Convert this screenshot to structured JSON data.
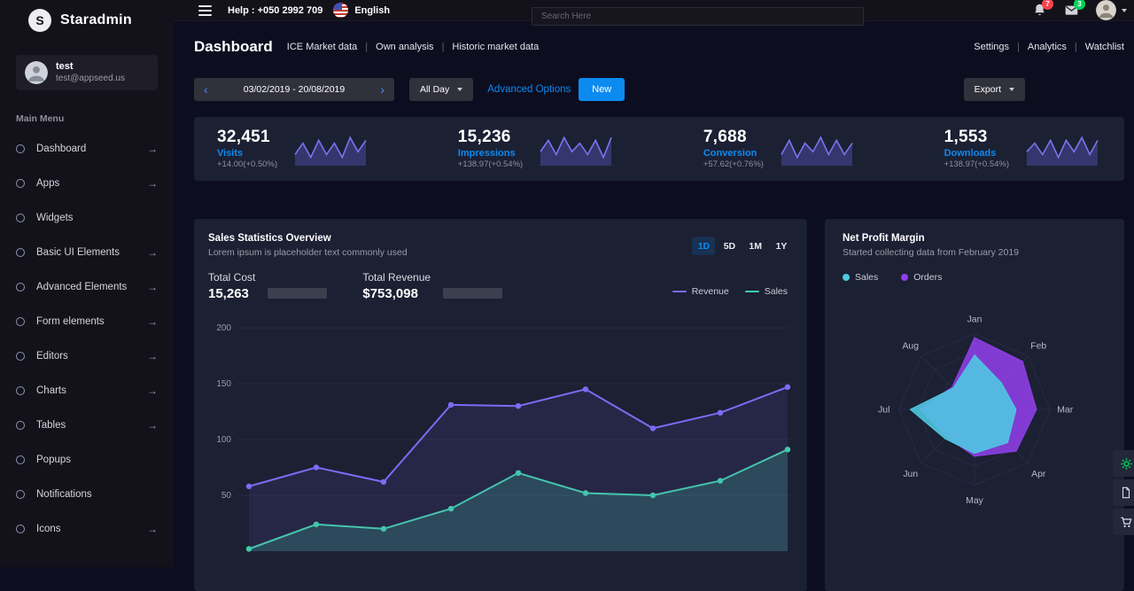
{
  "brand": {
    "initial": "S",
    "name": "Staradmin"
  },
  "topbar": {
    "help_label": "Help : +050 2992 709",
    "language": "English",
    "search_placeholder": "Search Here",
    "notification_count": "7",
    "message_count": "3"
  },
  "profile": {
    "name": "test",
    "email": "test@appseed.us"
  },
  "sidebar": {
    "section_label": "Main Menu",
    "menu": [
      {
        "label": "Dashboard",
        "has_children": true
      },
      {
        "label": "Apps",
        "has_children": true
      },
      {
        "label": "Widgets",
        "has_children": false
      },
      {
        "label": "Basic UI Elements",
        "has_children": true
      },
      {
        "label": "Advanced Elements",
        "has_children": true
      },
      {
        "label": "Form elements",
        "has_children": true
      },
      {
        "label": "Editors",
        "has_children": true
      },
      {
        "label": "Charts",
        "has_children": true
      },
      {
        "label": "Tables",
        "has_children": true
      },
      {
        "label": "Popups",
        "has_children": false
      },
      {
        "label": "Notifications",
        "has_children": false
      },
      {
        "label": "Icons",
        "has_children": true
      }
    ]
  },
  "page": {
    "title": "Dashboard",
    "subnav": [
      "ICE Market data",
      "Own analysis",
      "Historic market data"
    ],
    "quicklinks": [
      "Settings",
      "Analytics",
      "Watchlist"
    ]
  },
  "controls": {
    "date_range": "03/02/2019 - 20/08/2019",
    "day_filter": "All Day",
    "advanced_options_label": "Advanced Options",
    "new_label": "New",
    "export_label": "Export"
  },
  "stats": [
    {
      "value": "32,451",
      "label": "Visits",
      "change": "+14.00(+0.50%)",
      "spark": [
        3,
        7,
        2,
        8,
        3,
        7,
        2,
        9,
        4,
        8
      ]
    },
    {
      "value": "15,236",
      "label": "Impressions",
      "change": "+138.97(+0.54%)",
      "spark": [
        4,
        8,
        3,
        9,
        4,
        7,
        3,
        8,
        2,
        9
      ]
    },
    {
      "value": "7,688",
      "label": "Conversion",
      "change": "+57.62(+0.76%)",
      "spark": [
        3,
        8,
        2,
        7,
        4,
        9,
        3,
        8,
        3,
        7
      ]
    },
    {
      "value": "1,553",
      "label": "Downloads",
      "change": "+138.97(+0.54%)",
      "spark": [
        4,
        7,
        3,
        8,
        2,
        8,
        4,
        9,
        3,
        8
      ]
    }
  ],
  "sales_panel": {
    "tabs": [
      "1D",
      "5D",
      "1M",
      "1Y"
    ],
    "active_tab": "1D",
    "total_cost_label": "Total Cost",
    "total_cost_value": "15,263",
    "total_revenue_label": "Total Revenue",
    "total_revenue_value": "$753,098"
  },
  "colors": {
    "accent_blue": "#0d8af0",
    "badge_red": "#fc424a",
    "badge_green": "#00d25b",
    "revenue_purple": "#7b6cf6",
    "sales_green": "#3fd0a6",
    "radar_cyan": "#4ec9e2",
    "radar_violet": "#8f3fe8"
  },
  "chart_data": [
    {
      "type": "line",
      "title": "Sales Statistics Overview",
      "subtitle": "Lorem ipsum is placeholder text commonly used",
      "x": [
        1,
        2,
        3,
        4,
        5,
        6,
        7,
        8,
        9
      ],
      "series": [
        {
          "name": "Revenue",
          "color": "#7b6cf6",
          "fill": "rgba(123,108,246,0.10)",
          "values": [
            58,
            75,
            62,
            131,
            130,
            145,
            110,
            124,
            147
          ]
        },
        {
          "name": "Sales",
          "color": "#3fd0a6",
          "fill": "rgba(63,208,166,0.22)",
          "values": [
            2,
            24,
            20,
            38,
            70,
            52,
            50,
            63,
            91
          ]
        }
      ],
      "ylim": [
        0,
        200
      ],
      "yticks": [
        50,
        100,
        150,
        200
      ],
      "grid": true,
      "legend_position": "top-right"
    },
    {
      "type": "radar",
      "title": "Net Profit Margin",
      "subtitle": "Started collecting data from February 2019",
      "categories": [
        "Jan",
        "Feb",
        "Mar",
        "Apr",
        "May",
        "Jun",
        "Jul",
        "Aug"
      ],
      "max": 100,
      "series": [
        {
          "name": "Sales",
          "color": "#4ec9e2",
          "values": [
            72,
            50,
            55,
            62,
            58,
            55,
            85,
            40
          ]
        },
        {
          "name": "Orders",
          "color": "#8f3fe8",
          "values": [
            95,
            90,
            82,
            78,
            62,
            52,
            72,
            42
          ]
        }
      ],
      "legend_position": "top-left"
    }
  ]
}
